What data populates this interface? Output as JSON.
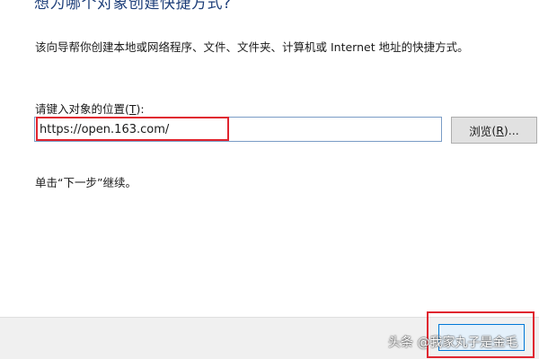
{
  "wizard": {
    "heading": "想为哪个对象创建快捷方式?",
    "description": "该向导帮你创建本地或网络程序、文件、文件夹、计算机或 Internet 地址的快捷方式。",
    "location_label": "请键入对象的位置",
    "location_label_mnemonic_open": "(",
    "location_label_mnemonic_key": "T",
    "location_label_mnemonic_close": "):",
    "location_value": "https://open.163.com/",
    "browse_label": "浏览",
    "browse_mnemonic_open": "(",
    "browse_mnemonic_key": "R",
    "browse_mnemonic_close": ")...",
    "continue_hint": "单击“下一步”继续。"
  },
  "annotations": {
    "highlight_color": "#e0242f"
  },
  "watermark": {
    "text": "头条 @我家丸子是金毛"
  },
  "colors": {
    "heading": "#1e3f7a",
    "next_button_border": "#0078d7",
    "footer_background": "#f0f0f0"
  }
}
